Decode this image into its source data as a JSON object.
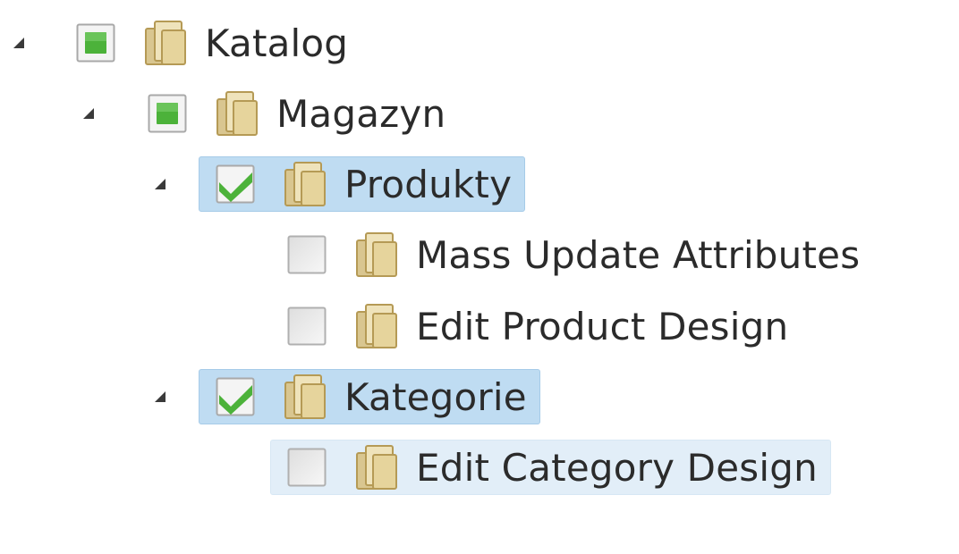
{
  "tree": {
    "nodes": [
      {
        "label": "Katalog",
        "level": 0,
        "expanded": true,
        "checkbox": "partial",
        "state": "normal"
      },
      {
        "label": "Magazyn",
        "level": 1,
        "expanded": true,
        "checkbox": "partial",
        "state": "normal"
      },
      {
        "label": "Produkty",
        "level": 2,
        "expanded": true,
        "checkbox": "checked",
        "state": "selected"
      },
      {
        "label": "Mass Update Attributes",
        "level": 3,
        "expanded": null,
        "checkbox": "unchecked",
        "state": "normal"
      },
      {
        "label": "Edit Product Design",
        "level": 3,
        "expanded": null,
        "checkbox": "unchecked",
        "state": "normal"
      },
      {
        "label": "Kategorie",
        "level": 2,
        "expanded": true,
        "checkbox": "checked",
        "state": "selected"
      },
      {
        "label": "Edit Category Design",
        "level": 3,
        "expanded": null,
        "checkbox": "unchecked",
        "state": "hovered"
      }
    ]
  },
  "colors": {
    "selected_bg": "#bfdcf2",
    "hover_bg": "#e2eef8",
    "check_green": "#4cb23a",
    "text": "#2b2b2b"
  },
  "icons": {
    "toggle": "expanded-triangle-icon",
    "folder": "folder-icon",
    "checkbox_partial": "checkbox-partial-icon",
    "checkbox_checked": "checkbox-checked-icon",
    "checkbox_unchecked": "checkbox-unchecked-icon"
  }
}
